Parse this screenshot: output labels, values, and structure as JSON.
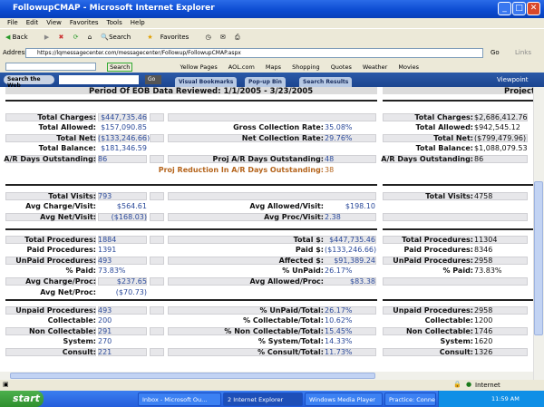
{
  "window": {
    "title": "FollowupCMAP - Microsoft Internet Explorer"
  },
  "menu": [
    "File",
    "Edit",
    "View",
    "Favorites",
    "Tools",
    "Help"
  ],
  "toolbar": {
    "back": "Back",
    "search": "Search",
    "favorites": "Favorites"
  },
  "address": {
    "label": "Address",
    "url": "https://lqmessagecenter.com/messagecenter/Followup/FollowupCMAP.aspx",
    "go": "Go",
    "links": "Links"
  },
  "links_bar": {
    "search_btn": "Search",
    "items": [
      "Yellow Pages",
      "AOL.com",
      "Maps",
      "Shopping",
      "Quotes",
      "Weather",
      "Movies"
    ]
  },
  "viewpoint": {
    "search_web": "Search the Web",
    "go": "Go",
    "tabs": [
      "Visual Bookmarks",
      "Pop-up Bin",
      "Search Results"
    ],
    "brand": "Viewpoint"
  },
  "header": {
    "period": "Period Of EOB Data Reviewed: 1/1/2005 - 3/23/2005",
    "project": "Project"
  },
  "colors": {
    "value": "#2b4a9a",
    "highlight": "#b5651d"
  },
  "sections": [
    {
      "rows": [
        {
          "ll": "Total Charges:",
          "lv": "$447,735.46",
          "rl": "Total Charges:",
          "rv": "$2,686,412.76"
        },
        {
          "ll": "Total Allowed:",
          "lv": "$157,090.85",
          "ml": "Gross Collection Rate:",
          "mv": "35.08%",
          "rl": "Total Allowed:",
          "rv": "$942,545.12"
        },
        {
          "ll": "Total Net:",
          "lv": "($133,246.66)",
          "ml": "Net Collection Rate:",
          "mv": "29.76%",
          "rl": "Total Net:",
          "rv": "($799,479.96)"
        },
        {
          "ll": "Total Balance:",
          "lv": "$181,346.59",
          "rl": "Total Balance:",
          "rv": "$1,088,079.53"
        },
        {
          "ll": "A/R Days Outstanding:",
          "lv": "86",
          "ml": "Proj A/R Days Outstanding:",
          "mv": "48",
          "rl": "A/R Days Outstanding:",
          "rv": "86"
        },
        {
          "ml": "Proj Reduction In A/R Days Outstanding:",
          "mv": "38",
          "highlight": true
        }
      ]
    },
    {
      "rows": [
        {
          "ll": "Total Visits:",
          "lv": "793",
          "rl": "Total Visits:",
          "rv": "4758"
        },
        {
          "ll": "Avg Charge/Visit:",
          "lv": "$564.61",
          "ml": "Avg Allowed/Visit:",
          "mv": "$198.10"
        },
        {
          "ll": "Avg Net/Visit:",
          "lv": "($168.03)",
          "ml": "Avg Proc/Visit:",
          "mv": "2.38"
        }
      ]
    },
    {
      "rows": [
        {
          "ll": "Total Procedures:",
          "lv": "1884",
          "icon": true,
          "ml": "Total $:",
          "mv": "$447,735.46",
          "rl": "Total Procedures:",
          "rv": "11304"
        },
        {
          "ll": "Paid Procedures:",
          "lv": "1391",
          "ml": "Paid $:",
          "mv": "($133,246.66)",
          "rl": "Paid Procedures:",
          "rv": "8346"
        },
        {
          "ll": "UnPaid Procedures:",
          "lv": "493",
          "icon": true,
          "ml": "Affected $:",
          "mv": "$91,389.24",
          "rl": "UnPaid Procedures:",
          "rv": "2958"
        },
        {
          "ll": "% Paid:",
          "lv": "73.83%",
          "ml": "% UnPaid:",
          "mv": "26.17%",
          "rl": "% Paid:",
          "rv": "73.83%"
        },
        {
          "ll": "Avg Charge/Proc:",
          "lv": "$237.65",
          "ml": "Avg Allowed/Proc:",
          "mv": "$83.38"
        },
        {
          "ll": "Avg Net/Proc:",
          "lv": "($70.73)"
        }
      ]
    },
    {
      "rows": [
        {
          "ll": "Unpaid Procedures:",
          "lv": "493",
          "ml": "% UnPaid/Total:",
          "mv": "26.17%",
          "rl": "Unpaid Procedures:",
          "rv": "2958"
        },
        {
          "ll": "Collectable:",
          "lv": "200",
          "ml": "% Collectable/Total:",
          "mv": "10.62%",
          "rl": "Collectable:",
          "rv": "1200"
        },
        {
          "ll": "Non Collectable:",
          "lv": "291",
          "ml": "% Non Collectable/Total:",
          "mv": "15.45%",
          "rl": "Non Collectable:",
          "rv": "1746"
        },
        {
          "ll": "System:",
          "lv": "270",
          "ml": "% System/Total:",
          "mv": "14.33%",
          "rl": "System:",
          "rv": "1620"
        },
        {
          "ll": "Consult:",
          "lv": "221",
          "ml": "% Consult/Total:",
          "mv": "11.73%",
          "rl": "Consult:",
          "rv": "1326"
        }
      ]
    }
  ],
  "status": {
    "zone": "Internet"
  },
  "taskbar": {
    "start": "start",
    "tasks": [
      "Inbox - Microsoft Ou...",
      "2 Internet Explorer",
      "Windows Media Player",
      "Practice: Connectiu..."
    ],
    "clock": "11:59 AM"
  }
}
